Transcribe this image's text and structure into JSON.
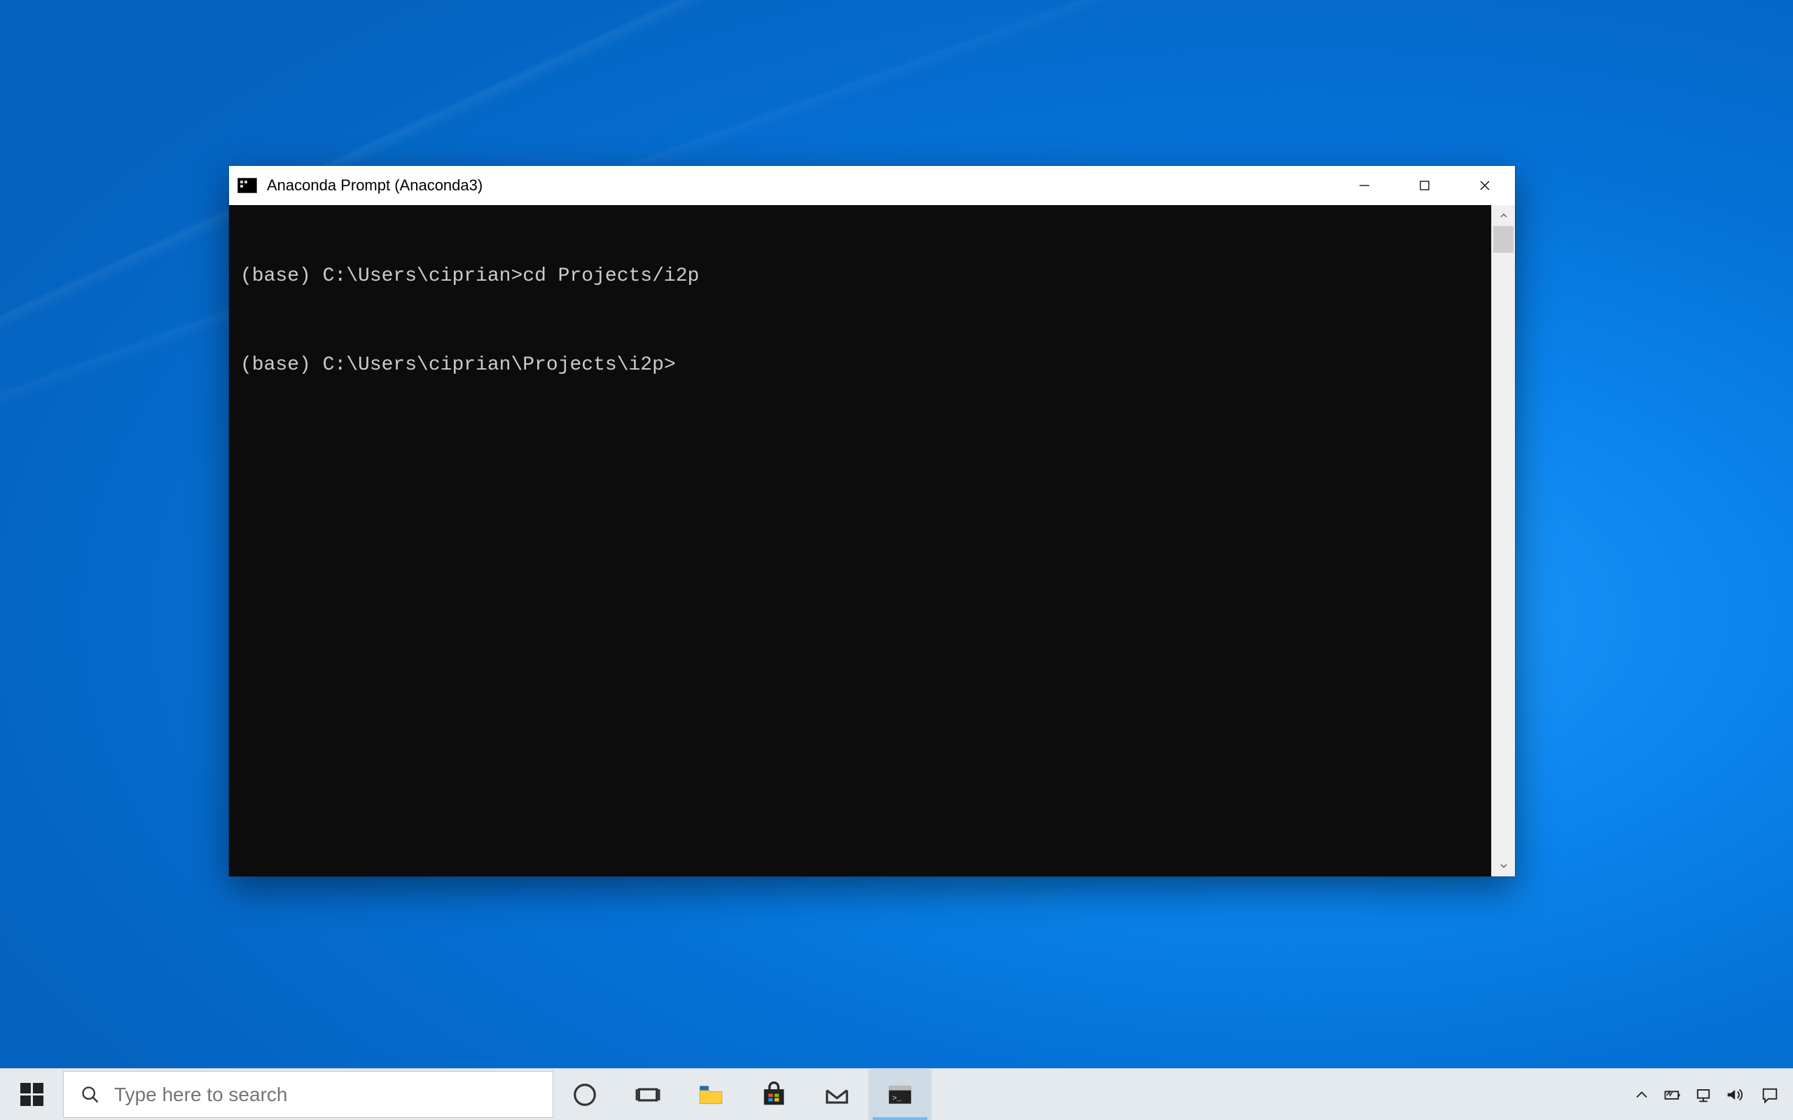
{
  "window": {
    "title": "Anaconda Prompt (Anaconda3)"
  },
  "terminal": {
    "lines": [
      "(base) C:\\Users\\ciprian>cd Projects/i2p",
      "(base) C:\\Users\\ciprian\\Projects\\i2p>"
    ]
  },
  "taskbar": {
    "search_placeholder": "Type here to search"
  }
}
